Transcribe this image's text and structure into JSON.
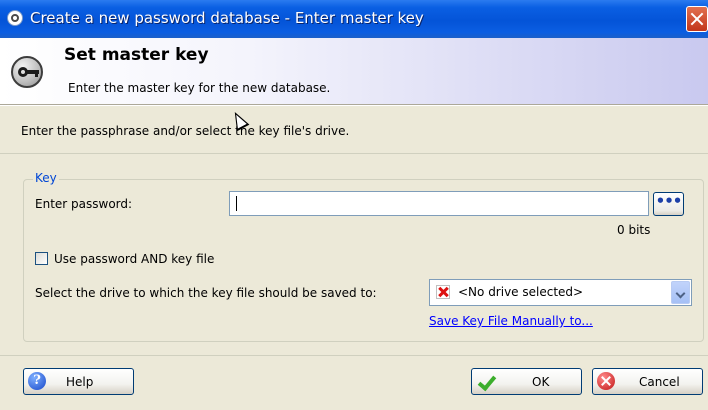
{
  "window": {
    "title": "Create a new password database - Enter master key"
  },
  "banner": {
    "title": "Set master key",
    "subtitle": "Enter the master key for the new database."
  },
  "info_text": "Enter the passphrase and/or select the key file's drive.",
  "key_group": {
    "label": "Key",
    "password_label": "Enter password:",
    "password_value": "",
    "reveal_button": "•••",
    "bits_text": "0 bits",
    "use_both_label": "Use password AND key file",
    "use_both_checked": false,
    "drive_label": "Select the drive to which the key file should be saved to:",
    "drive_selected": "<No drive selected>",
    "save_manual_link": "Save Key File Manually to..."
  },
  "buttons": {
    "help": "Help",
    "ok": "OK",
    "cancel": "Cancel"
  },
  "icons": [
    "app-lock-icon",
    "close-icon",
    "key-icon",
    "no-drive-icon",
    "dropdown-arrow-icon",
    "help-icon",
    "ok-check-icon",
    "cancel-icon",
    "mouse-cursor-icon"
  ]
}
